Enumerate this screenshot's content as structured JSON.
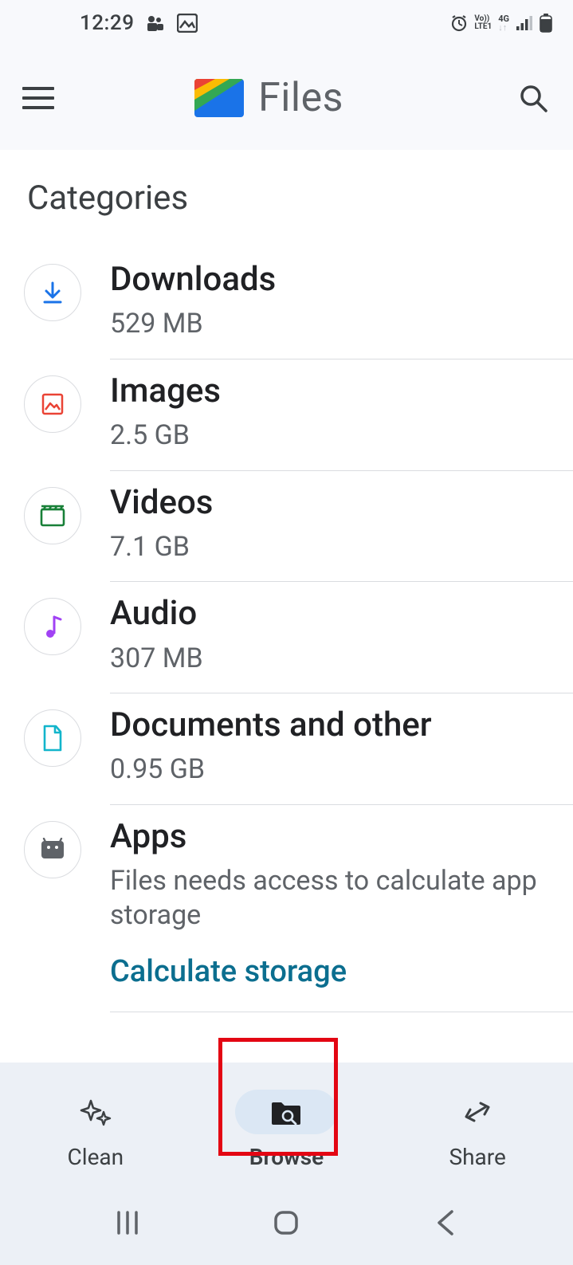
{
  "status": {
    "time": "12:29"
  },
  "header": {
    "title": "Files"
  },
  "section": {
    "title": "Categories"
  },
  "categories": [
    {
      "name": "Downloads",
      "sub": "529 MB"
    },
    {
      "name": "Images",
      "sub": "2.5 GB"
    },
    {
      "name": "Videos",
      "sub": "7.1 GB"
    },
    {
      "name": "Audio",
      "sub": "307 MB"
    },
    {
      "name": "Documents and other",
      "sub": "0.95 GB"
    },
    {
      "name": "Apps",
      "sub": "Files needs access to calculate app storage",
      "link": "Calculate storage"
    }
  ],
  "bottom_nav": {
    "clean": "Clean",
    "browse": "Browse",
    "share": "Share"
  }
}
